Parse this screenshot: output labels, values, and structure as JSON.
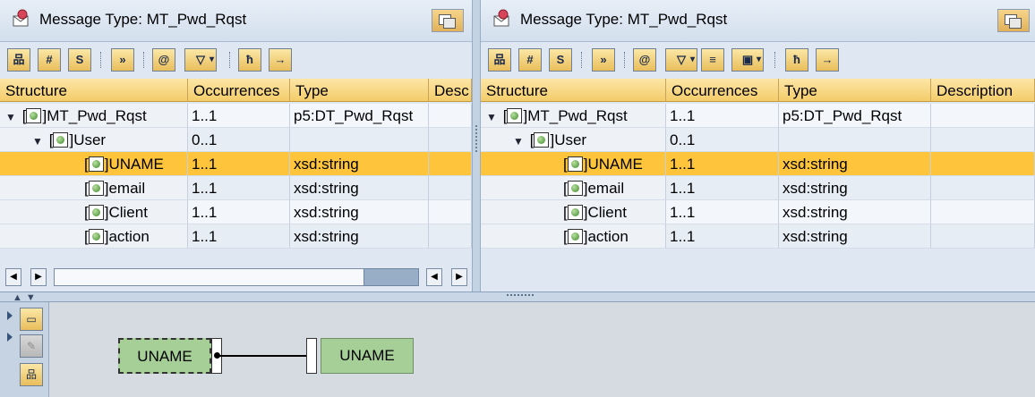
{
  "left_pane": {
    "title": "Message Type: MT_Pwd_Rqst",
    "columns": [
      "Structure",
      "Occurrences",
      "Type",
      "Desc"
    ],
    "rows": [
      {
        "structure": "MT_Pwd_Rqst",
        "occ": "1..1",
        "type": "p5:DT_Pwd_Rqst",
        "desc": ""
      },
      {
        "structure": "User",
        "occ": "0..1",
        "type": "",
        "desc": ""
      },
      {
        "structure": "UNAME",
        "occ": "1..1",
        "type": "xsd:string",
        "desc": ""
      },
      {
        "structure": "email",
        "occ": "1..1",
        "type": "xsd:string",
        "desc": ""
      },
      {
        "structure": "Client",
        "occ": "1..1",
        "type": "xsd:string",
        "desc": ""
      },
      {
        "structure": "action",
        "occ": "1..1",
        "type": "xsd:string",
        "desc": ""
      }
    ]
  },
  "right_pane": {
    "title": "Message Type: MT_Pwd_Rqst",
    "columns": [
      "Structure",
      "Occurrences",
      "Type",
      "Description"
    ],
    "rows": [
      {
        "structure": "MT_Pwd_Rqst",
        "occ": "1..1",
        "type": "p5:DT_Pwd_Rqst",
        "desc": ""
      },
      {
        "structure": "User",
        "occ": "0..1",
        "type": "",
        "desc": ""
      },
      {
        "structure": "UNAME",
        "occ": "1..1",
        "type": "xsd:string",
        "desc": ""
      },
      {
        "structure": "email",
        "occ": "1..1",
        "type": "xsd:string",
        "desc": ""
      },
      {
        "structure": "Client",
        "occ": "1..1",
        "type": "xsd:string",
        "desc": ""
      },
      {
        "structure": "action",
        "occ": "1..1",
        "type": "xsd:string",
        "desc": ""
      }
    ]
  },
  "selected_row": "UNAME",
  "mapping": {
    "source_label": "UNAME",
    "target_label": "UNAME"
  },
  "colors": {
    "selection": "#fdc43c",
    "header": "#f4cc6a",
    "node_box": "#a6cf98",
    "pane_bg": "#dfe8f2"
  },
  "icons": {
    "title": "message-type-icon",
    "toolbar": [
      "hierarchy-icon",
      "table-grid-icon",
      "source-icon",
      "expand-all-icon",
      "namespace-icon",
      "filter-icon",
      "display-queue-icon",
      "test-icon",
      "find-icon",
      "find-next-icon"
    ],
    "mapping_toolbar": [
      "expand-icon",
      "edit-icon",
      "structure-icon"
    ]
  }
}
